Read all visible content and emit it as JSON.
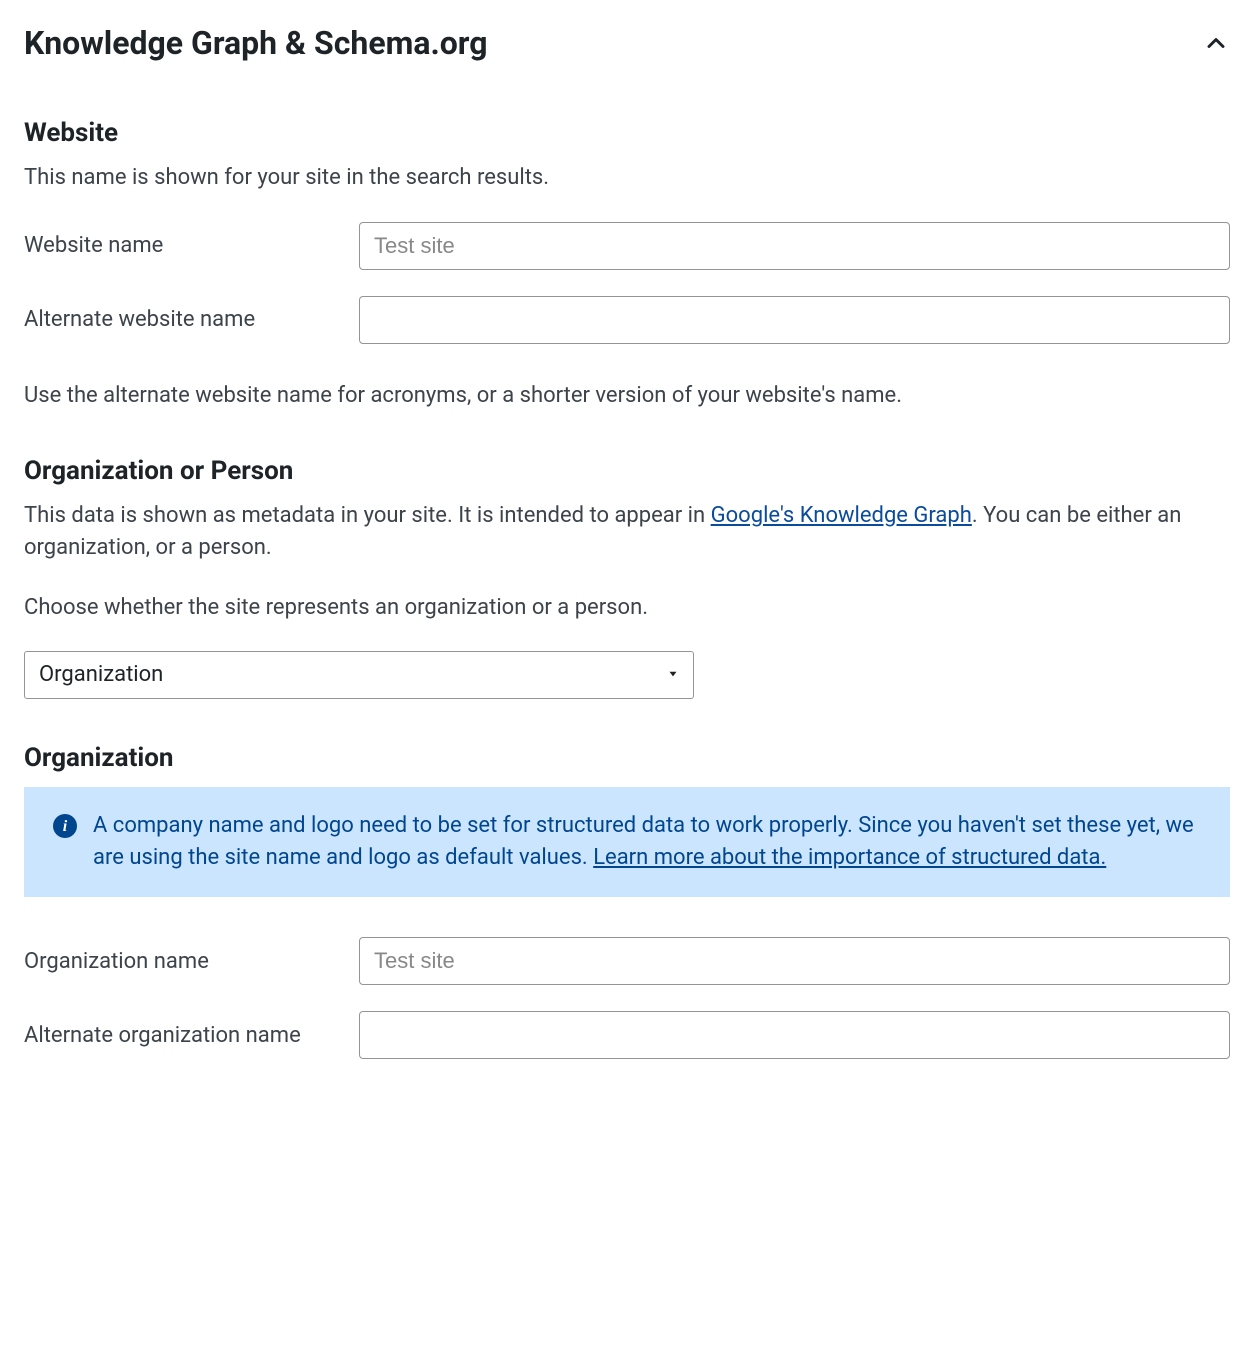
{
  "panel": {
    "title": "Knowledge Graph & Schema.org"
  },
  "website": {
    "heading": "Website",
    "description": "This name is shown for your site in the search results.",
    "name_label": "Website name",
    "name_placeholder": "Test site",
    "name_value": "",
    "alt_name_label": "Alternate website name",
    "alt_name_value": "",
    "note": "Use the alternate website name for acronyms, or a shorter version of your website's name."
  },
  "org_person": {
    "heading": "Organization or Person",
    "desc_prefix": "This data is shown as metadata in your site. It is intended to appear in ",
    "link_text": "Google's Knowledge Graph",
    "desc_suffix": ". You can be either an organization, or a person.",
    "choose_label": "Choose whether the site represents an organization or a person.",
    "selected": "Organization"
  },
  "organization": {
    "heading": "Organization",
    "info_text_prefix": "A company name and logo need to be set for structured data to work properly. Since you haven't set these yet, we are using the site name and logo as default values. ",
    "info_link": "Learn more about the importance of structured data.",
    "name_label": "Organization name",
    "name_placeholder": "Test site",
    "name_value": "",
    "alt_name_label": "Alternate organization name",
    "alt_name_value": ""
  }
}
